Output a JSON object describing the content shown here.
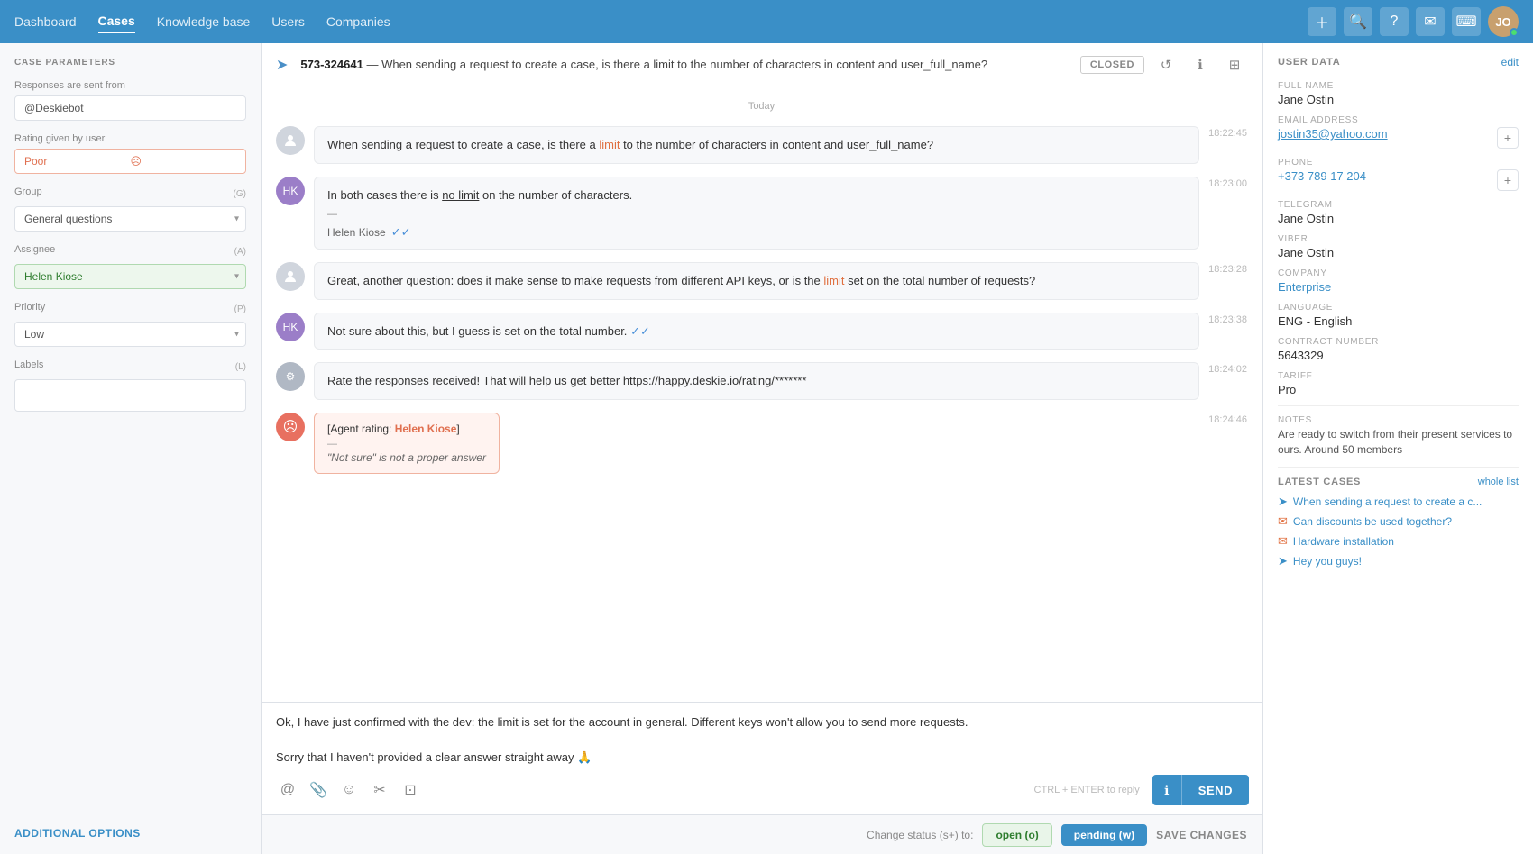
{
  "nav": {
    "items": [
      {
        "id": "dashboard",
        "label": "Dashboard",
        "active": false
      },
      {
        "id": "cases",
        "label": "Cases",
        "active": true
      },
      {
        "id": "knowledge",
        "label": "Knowledge base",
        "active": false
      },
      {
        "id": "users",
        "label": "Users",
        "active": false
      },
      {
        "id": "companies",
        "label": "Companies",
        "active": false
      }
    ],
    "icons": {
      "plus": "+",
      "search": "🔍",
      "help": "?",
      "message": "✉",
      "keyboard": "⌨"
    }
  },
  "left_panel": {
    "section_title": "CASE PARAMETERS",
    "responses_label": "Responses are sent from",
    "responses_value": "@Deskiebot",
    "rating_label": "Rating given by user",
    "rating_value": "Poor",
    "group_label": "Group",
    "group_shortcut": "(G)",
    "group_value": "General questions",
    "assignee_label": "Assignee",
    "assignee_shortcut": "(A)",
    "assignee_value": "Helen Kiose",
    "priority_label": "Priority",
    "priority_shortcut": "(P)",
    "priority_value": "Low",
    "labels_label": "Labels",
    "labels_shortcut": "(L)",
    "additional_options": "ADDITIONAL OPTIONS"
  },
  "case_header": {
    "case_id": "573-324641",
    "separator": "—",
    "title": "When sending a request to create a case, is there a limit to the number of characters in content and user_full_name?",
    "status": "CLOSED"
  },
  "messages": {
    "day_divider": "Today",
    "items": [
      {
        "id": "msg1",
        "type": "user",
        "text": "When sending a request to create a case, is there a limit to the number of characters in content and user_full_name?",
        "time": "18:22:45"
      },
      {
        "id": "msg2",
        "type": "agent",
        "text": "In both cases there is no limit on the number of characters.",
        "agent": "Helen Kiose",
        "time": "18:23:00"
      },
      {
        "id": "msg3",
        "type": "user",
        "text": "Great, another question: does it make sense to make requests from different API keys, or is the limit set on the total number of requests?",
        "time": "18:23:28"
      },
      {
        "id": "msg4",
        "type": "agent",
        "text": "Not sure about this, but I guess is set on the total number.",
        "agent": "Helen Kiose",
        "time": "18:23:38"
      },
      {
        "id": "msg5",
        "type": "bot",
        "text": "Rate the responses received! That will help us get better https://happy.deskie.io/rating/*******",
        "time": "18:24:02"
      },
      {
        "id": "msg6",
        "type": "rating",
        "agent": "Helen Kiose",
        "title_prefix": "[Agent rating: ",
        "title_agent": "Helen Kiose",
        "title_suffix": "]",
        "dash": "—",
        "note": "\"Not sure\" is not a proper answer",
        "time": "18:24:46"
      }
    ]
  },
  "compose": {
    "text_line1": "Ok, I have just confirmed with the dev: the limit is set for the account in general. Different keys won't allow you to send more requests.",
    "text_line2": "",
    "text_line3": "Sorry that I haven't provided a clear answer straight away 🙏",
    "hint": "CTRL + ENTER to reply",
    "send_label": "SEND"
  },
  "status_bar": {
    "label": "Change status (s+) to:",
    "open_label": "open (o)",
    "pending_label": "pending (w)",
    "save_label": "SAVE CHANGES"
  },
  "right_panel": {
    "section_title": "USER DATA",
    "edit_label": "edit",
    "full_name_label": "FULL NAME",
    "full_name": "Jane Ostin",
    "email_label": "EMAIL ADDRESS",
    "email": "jostin35@yahoo.com",
    "phone_label": "PHONE",
    "phone": "+373 789 17 204",
    "telegram_label": "TELEGRAM",
    "telegram": "Jane Ostin",
    "viber_label": "VIBER",
    "viber": "Jane Ostin",
    "company_label": "COMPANY",
    "company": "Enterprise",
    "language_label": "LANGUAGE",
    "language": "ENG - English",
    "contract_label": "CONTRACT NUMBER",
    "contract": "5643329",
    "tariff_label": "TARIFF",
    "tariff": "Pro",
    "notes_label": "NOTES",
    "notes": "Are ready to switch from their present services to ours. Around 50 members",
    "latest_cases_label": "LATEST CASES",
    "whole_list_label": "whole list",
    "latest_cases": [
      {
        "icon": "arrow",
        "text": "When sending a request to create a c..."
      },
      {
        "icon": "email",
        "text": "Can discounts be used together?"
      },
      {
        "icon": "email",
        "text": "Hardware installation"
      },
      {
        "icon": "arrow",
        "text": "Hey you guys!"
      }
    ]
  }
}
